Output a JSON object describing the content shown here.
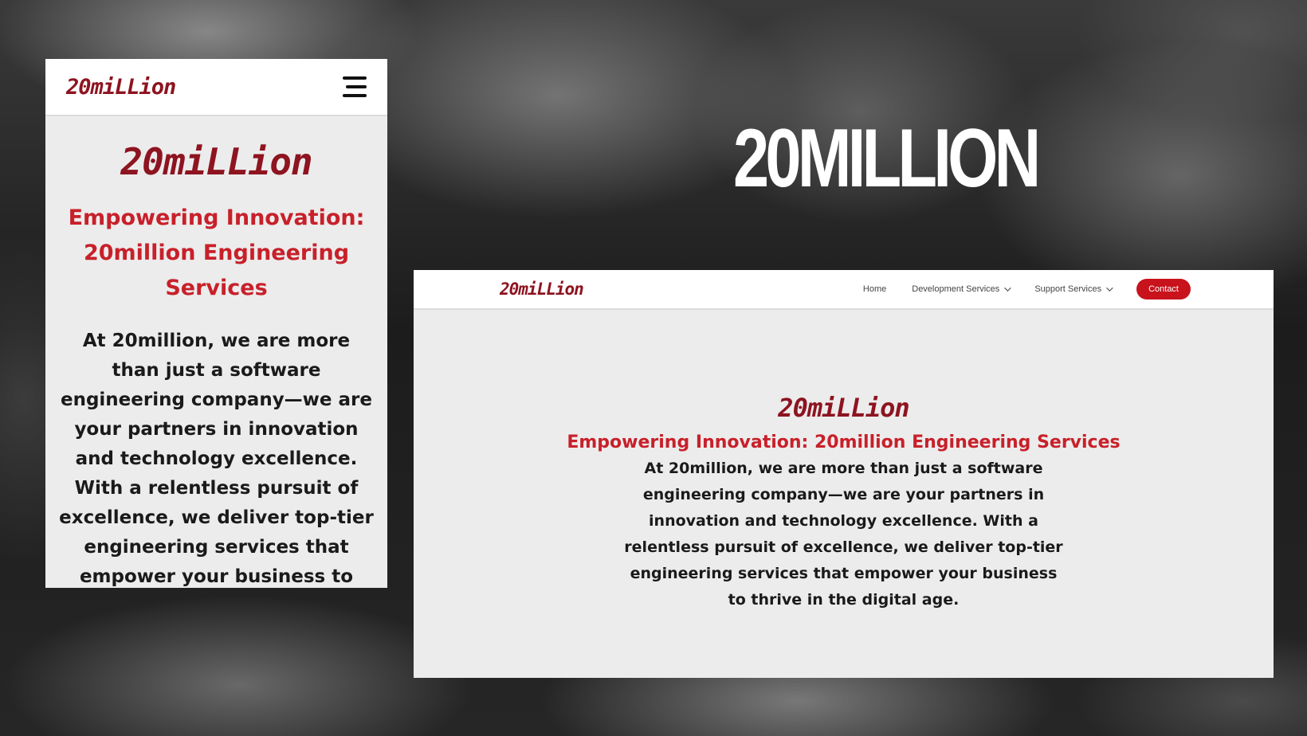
{
  "brand": {
    "logo_text": "20miLLion"
  },
  "banner": {
    "title": "20MILLION"
  },
  "mobile": {
    "hero_title": "Empowering Innovation: 20million Engineering Services",
    "hero_text": "At 20million, we are more than just a software engineering company—we are your partners in innovation and technology excellence. With a relentless pursuit of excellence, we deliver top-tier engineering services that empower your business to"
  },
  "desktop": {
    "nav": {
      "home": "Home",
      "development": "Development Services",
      "support": "Support Services",
      "contact": "Contact"
    },
    "hero_title": "Empowering Innovation: 20million Engineering Services",
    "hero_text": "At 20million, we are more than just a software engineering company—we are your partners in innovation and technology excellence. With a relentless pursuit of excellence, we deliver top-tier engineering services that empower your business to thrive in the digital age."
  },
  "colors": {
    "accent": "#c8202a",
    "logo": "#8d1420",
    "button": "#c8121c"
  },
  "icons": {
    "menu": "hamburger-icon",
    "dropdown": "chevron-down-icon"
  }
}
